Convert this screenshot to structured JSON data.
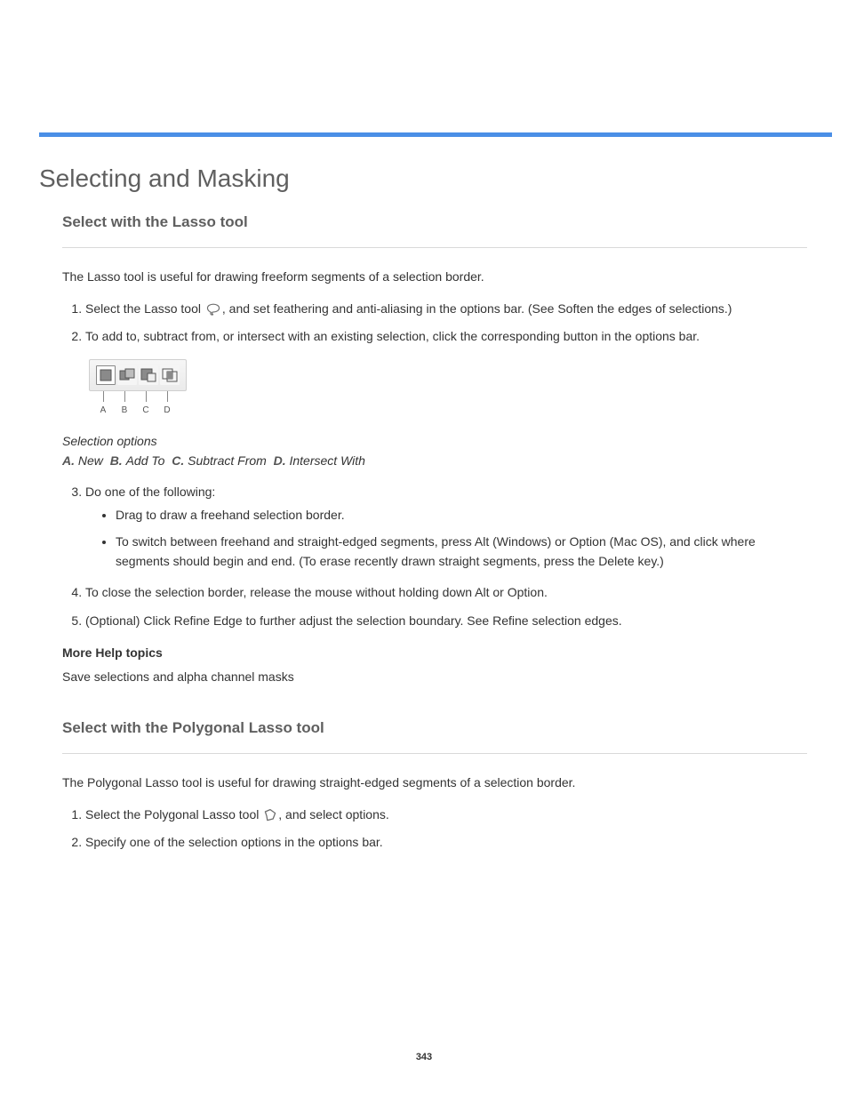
{
  "doc_title": "Selecting and Masking",
  "sections": {
    "lasso": {
      "title": "Select with the Lasso tool",
      "intro": "The Lasso tool is useful for drawing freeform segments of a selection border.",
      "steps": {
        "s1_pre": "Select the Lasso tool",
        "s1_post": ", and set feathering and anti-aliasing in the options bar. (See Soften the edges of selections.)",
        "s2": "To add to, subtract from, or intersect with an existing selection, click the corresponding button in the options bar."
      },
      "palette_caption_label": "Selection options",
      "palette_legend": {
        "A": "New",
        "B": "Add To",
        "C": "Subtract From",
        "D": "Intersect With"
      },
      "step3_lead": "Do one of the following:",
      "bullets": {
        "b1": "Drag to draw a freehand selection border.",
        "b2": "To switch between freehand and straight-edged segments, press Alt (Windows) or Option (Mac OS), and click where segments should begin and end. (To erase recently drawn straight segments, press the Delete key.)"
      },
      "step4": "To close the selection border, release the mouse without holding down Alt or Option.",
      "step5": "(Optional) Click Refine Edge to further adjust the selection boundary. See Refine selection edges.",
      "see_also_heading": "More Help topics",
      "see_also": "Save selections and alpha channel masks"
    },
    "polygonal": {
      "title": "Select with the Polygonal Lasso tool",
      "intro": "The Polygonal Lasso tool is useful for drawing straight-edged segments of a selection border.",
      "steps": {
        "s1_pre": "Select the Polygonal Lasso tool",
        "s1_post": ", and select options.",
        "s2": "Specify one of the selection options in the options bar."
      }
    }
  },
  "page_number": "343"
}
